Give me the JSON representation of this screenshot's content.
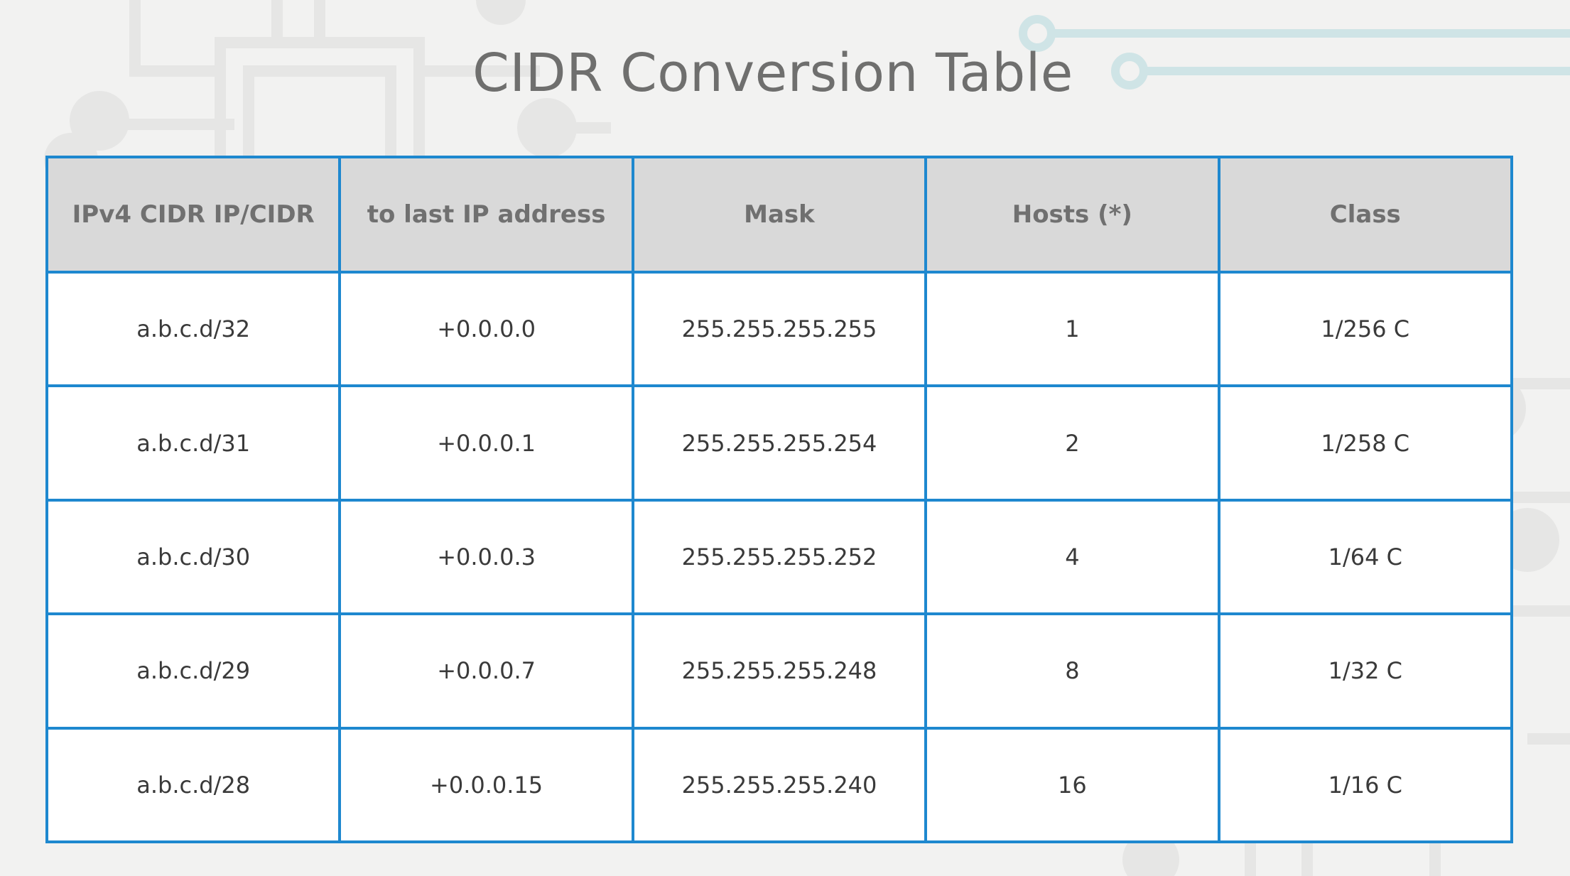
{
  "title": "CIDR Conversion Table",
  "colors": {
    "background": "#f2f2f1",
    "table_border": "#1e88cf",
    "header_background": "#d9d9d9",
    "decor_circuit": "#cfe4e6"
  },
  "table": {
    "columns": [
      "IPv4 CIDR IP/CIDR",
      "to last IP address",
      "Mask",
      "Hosts (*)",
      "Class"
    ],
    "rows": [
      [
        "a.b.c.d/32",
        "+0.0.0.0",
        "255.255.255.255",
        "1",
        "1/256 C"
      ],
      [
        "a.b.c.d/31",
        "+0.0.0.1",
        "255.255.255.254",
        "2",
        "1/258 C"
      ],
      [
        "a.b.c.d/30",
        "+0.0.0.3",
        "255.255.255.252",
        "4",
        "1/64 C"
      ],
      [
        "a.b.c.d/29",
        "+0.0.0.7",
        "255.255.255.248",
        "8",
        "1/32 C"
      ],
      [
        "a.b.c.d/28",
        "+0.0.0.15",
        "255.255.255.240",
        "16",
        "1/16 C"
      ]
    ]
  }
}
